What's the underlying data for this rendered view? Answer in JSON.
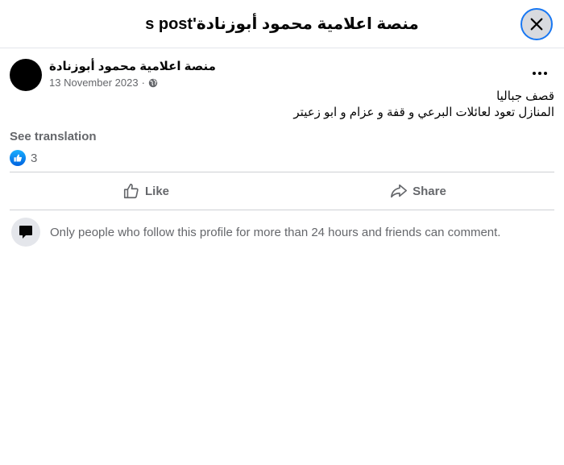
{
  "dialog": {
    "title": "منصة اعلامية محمود أبوزنادة's post",
    "close_icon": "close-icon"
  },
  "post": {
    "author": "منصة اعلامية محمود أبوزنادة",
    "date": "13 November 2023",
    "separator": "·",
    "privacy_icon": "globe-icon",
    "more_icon": "more-horizontal-icon",
    "text_lines": [
      "قصف جباليا",
      "المنازل تعود لعائلات البرعي و قفة و عزام و ابو زعيتر"
    ],
    "see_translation": "See translation",
    "reaction_icon": "like-reaction-icon",
    "reaction_count": "3"
  },
  "actions": {
    "like_label": "Like",
    "share_label": "Share"
  },
  "comment_notice": {
    "text": "Only people who follow this profile for more than 24 hours and friends can comment."
  },
  "colors": {
    "accent": "#1877f2",
    "secondary_text": "#65676b",
    "divider": "#ced0d4"
  }
}
